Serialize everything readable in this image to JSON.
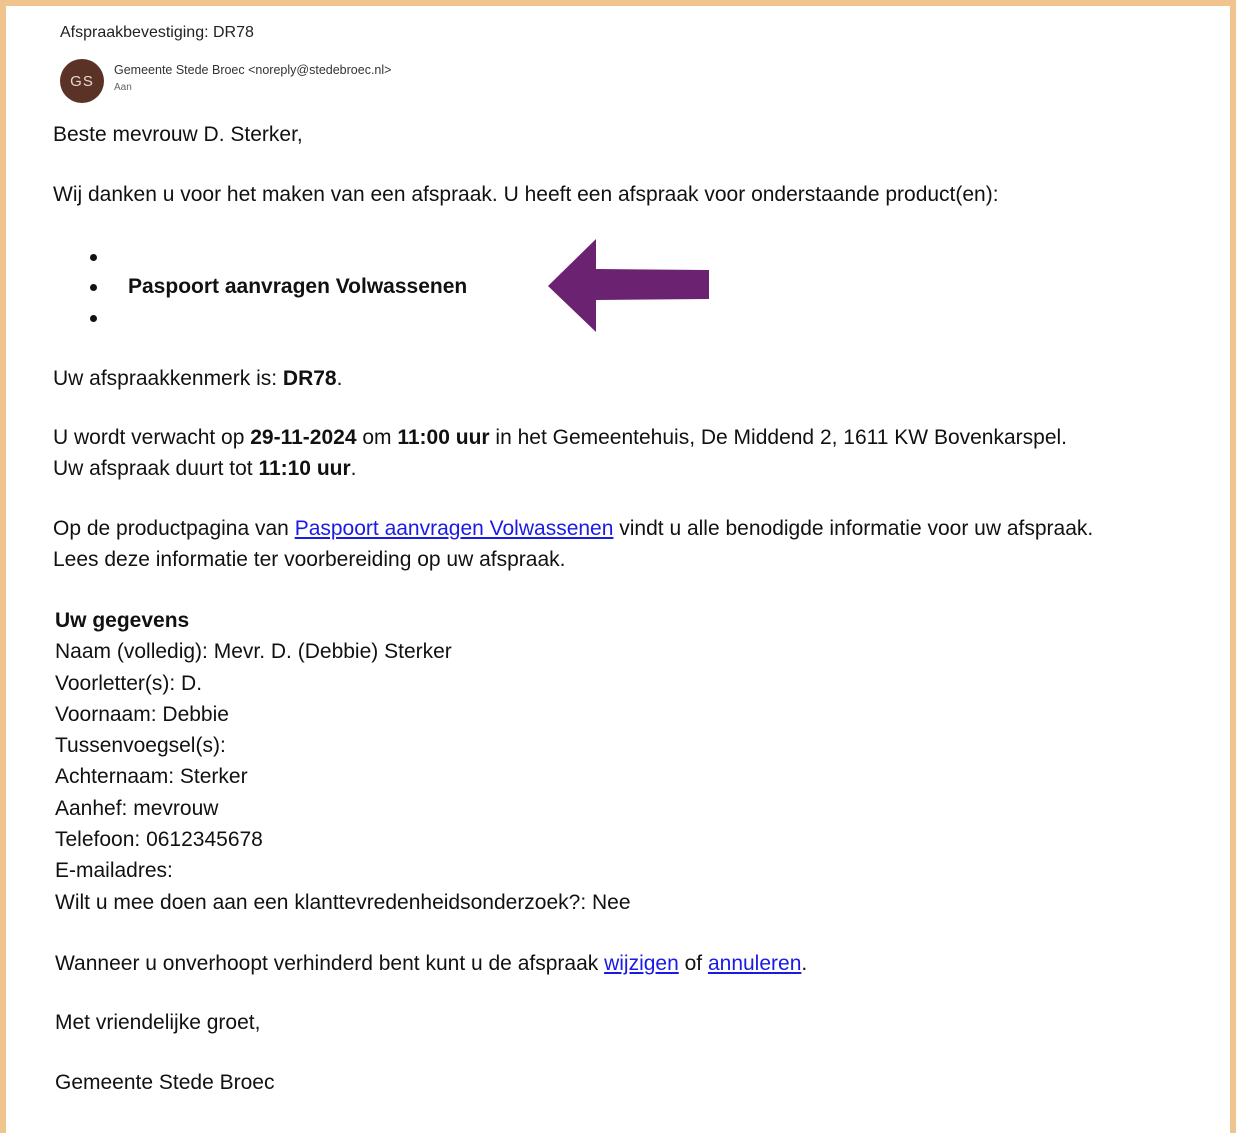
{
  "email": {
    "subject": "Afspraakbevestiging: DR78",
    "avatar_initials": "GS",
    "sender": "Gemeente Stede Broec <noreply@stedebroec.nl>",
    "to_label": "Aan"
  },
  "body": {
    "greeting": "Beste mevrouw D. Sterker,",
    "intro": "Wij danken u voor het maken van een afspraak. U heeft een afspraak voor onderstaande product(en):",
    "products": [
      "",
      "Paspoort aanvragen Volwassenen",
      ""
    ],
    "ref_prefix": "Uw afspraakkenmerk is: ",
    "ref_code": "DR78",
    "ref_suffix": ".",
    "when_1": "U wordt verwacht op ",
    "date": "29-11-2024",
    "when_2": " om ",
    "time": "11:00 uur",
    "when_3": " in het Gemeentehuis, De Middend 2, 1611 KW Bovenkarspel.",
    "duration_prefix": "Uw afspraak duurt tot ",
    "end_time": "11:10 uur",
    "duration_suffix": ".",
    "info_1": "Op de productpagina van ",
    "info_link": "Paspoort aanvragen Volwassenen",
    "info_2": " vindt u alle benodigde informatie voor uw afspraak.",
    "info_line2": "Lees deze informatie ter voorbereiding op uw afspraak.",
    "details_heading": "Uw gegevens",
    "details": [
      "Naam (volledig): Mevr. D. (Debbie) Sterker",
      "Voorletter(s): D.",
      "Voornaam: Debbie",
      "Tussenvoegsel(s):",
      "Achternaam: Sterker",
      "Aanhef: mevrouw",
      "Telefoon: 0612345678",
      "E-mailadres:",
      "Wilt u mee doen aan een klanttevredenheidsonderzoek?: Nee"
    ],
    "change_1": "Wanneer u onverhoopt verhinderd bent kunt u de afspraak ",
    "change_link": "wijzigen",
    "change_2": " of ",
    "cancel_link": "annuleren",
    "change_3": ".",
    "closing": "Met vriendelijke groet,",
    "signature": "Gemeente Stede Broec"
  },
  "colors": {
    "frame": "#f2c48d",
    "avatar_bg": "#5a3226",
    "arrow": "#6b2270",
    "link": "#1a1ae6"
  },
  "annotation": {
    "arrow_icon": "left-arrow-icon"
  }
}
